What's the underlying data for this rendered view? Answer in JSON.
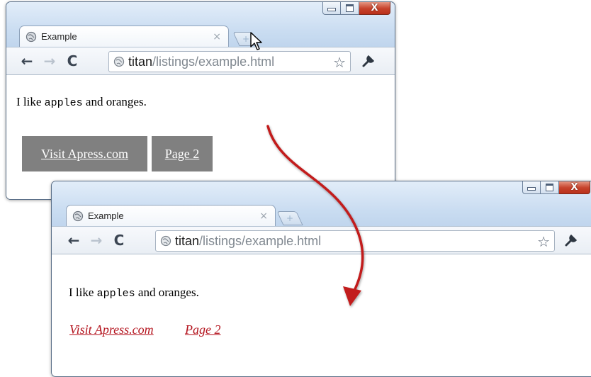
{
  "colors": {
    "link_red": "#b4141e",
    "button_gray": "#808080",
    "close_red": "#c7432c",
    "arrow_red": "#c21a1a"
  },
  "window_before": {
    "tab": {
      "title": "Example",
      "close_glyph": "×",
      "icon": "globe-icon"
    },
    "new_tab_glyph": "+",
    "controls": {
      "minimize": "minimize-icon",
      "maximize": "maximize-icon",
      "close": "X"
    },
    "toolbar": {
      "back_glyph": "←",
      "forward_glyph": "→",
      "reload_glyph": "C",
      "url_host": "titan",
      "url_path": "/listings/example.html",
      "star_glyph": "☆",
      "menu_icon": "wrench-icon"
    },
    "content": {
      "para_before": "I like ",
      "para_code": "apples",
      "para_after": " and oranges.",
      "links": [
        "Visit Apress.com",
        "Page 2"
      ]
    }
  },
  "window_after": {
    "tab": {
      "title": "Example",
      "close_glyph": "×",
      "icon": "globe-icon"
    },
    "new_tab_glyph": "+",
    "controls": {
      "minimize": "minimize-icon",
      "maximize": "maximize-icon",
      "close": "X"
    },
    "toolbar": {
      "back_glyph": "←",
      "forward_glyph": "→",
      "reload_glyph": "C",
      "url_host": "titan",
      "url_path": "/listings/example.html",
      "star_glyph": "☆",
      "menu_icon": "wrench-icon"
    },
    "content": {
      "para_before": "I like ",
      "para_code": "apples",
      "para_after": " and oranges.",
      "links": [
        "Visit Apress.com",
        "Page 2"
      ]
    }
  }
}
